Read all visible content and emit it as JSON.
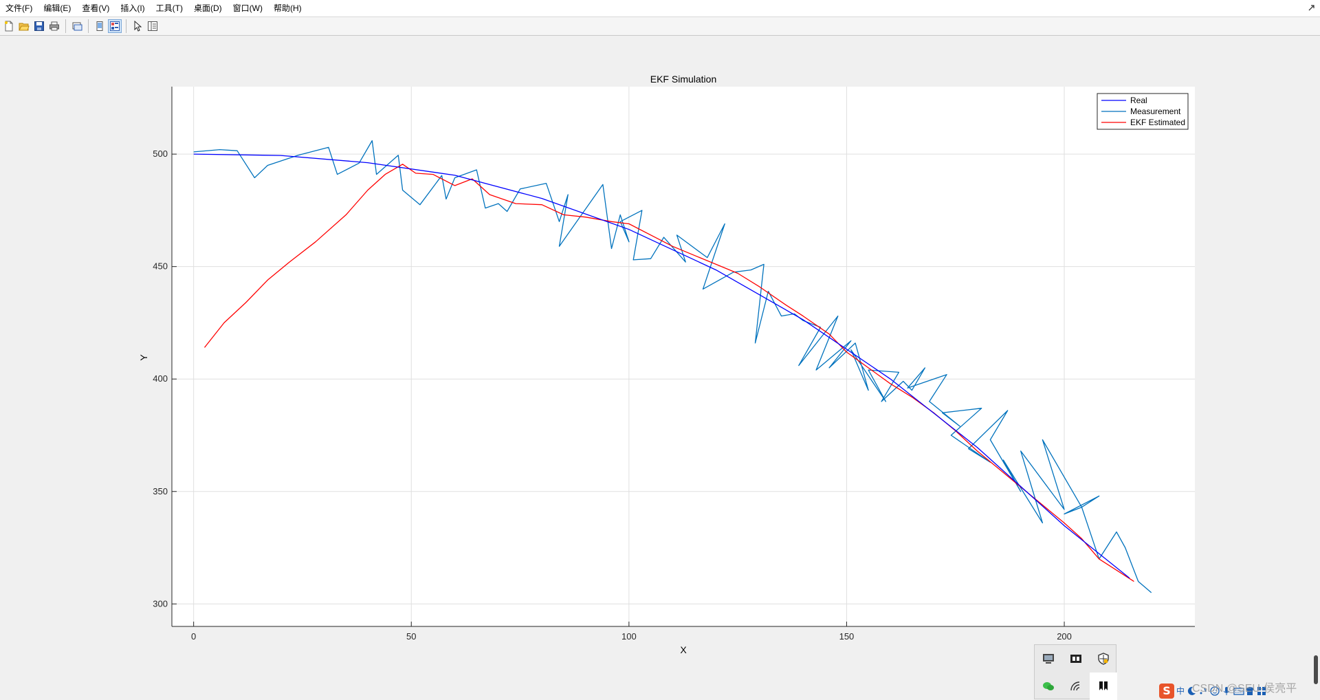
{
  "menubar": {
    "items": [
      "文件(F)",
      "编辑(E)",
      "查看(V)",
      "插入(I)",
      "工具(T)",
      "桌面(D)",
      "窗口(W)",
      "帮助(H)"
    ]
  },
  "toolbar": {
    "buttons": [
      "new-figure-icon",
      "open-file-icon",
      "save-icon",
      "print-icon",
      "link-plot-icon",
      "hide-plot-tools-icon",
      "show-plot-tools-icon",
      "edit-plot-icon",
      "property-inspector-icon"
    ]
  },
  "tray": {
    "icons": [
      "display-icon",
      "media-icon",
      "security-shield-icon",
      "wechat-icon",
      "wifi-icon",
      "bookmark-icon"
    ]
  },
  "taskbar": {
    "ime_logo": "S",
    "ime_text": "中"
  },
  "watermark": "CSDN @SEU-侯亮平",
  "colors": {
    "real": "#0000ff",
    "measurement": "#0072bd",
    "estimated": "#ff0000",
    "grid": "#dfdfdf"
  },
  "chart_data": {
    "type": "line",
    "title": "EKF Simulation",
    "xlabel": "X",
    "ylabel": "Y",
    "xlim": [
      -5,
      230
    ],
    "ylim": [
      290,
      530
    ],
    "xticks": [
      0,
      50,
      100,
      150,
      200
    ],
    "yticks": [
      300,
      350,
      400,
      450,
      500
    ],
    "grid": true,
    "legend_position": "top-right",
    "series": [
      {
        "name": "Real",
        "color": "#0000ff",
        "x": [
          0,
          20,
          40,
          60,
          80,
          100,
          120,
          140,
          160,
          180,
          200,
          215
        ],
        "y": [
          500,
          499.4,
          496.2,
          490.6,
          480.3,
          466.5,
          448.5,
          426.4,
          400.1,
          369.6,
          334.8,
          311.5
        ]
      },
      {
        "name": "Measurement",
        "color": "#0072bd",
        "x": [
          0,
          6,
          10,
          14,
          17,
          24,
          31,
          33,
          38,
          41,
          42,
          47,
          48,
          52,
          57,
          58,
          60,
          65,
          67,
          70,
          72,
          75,
          81,
          84,
          86,
          84,
          94,
          96,
          98,
          100,
          98,
          103,
          101,
          105,
          108,
          113,
          111,
          118,
          122,
          117,
          124,
          128,
          131,
          129,
          132,
          135,
          138,
          140,
          144,
          139,
          148,
          143,
          151,
          146,
          152,
          155,
          151,
          159,
          155,
          162,
          158,
          163,
          165,
          168,
          164,
          173,
          169,
          176,
          172,
          181,
          174,
          183,
          178,
          187,
          183,
          190,
          186,
          195,
          190,
          200,
          195,
          204,
          200,
          208,
          204,
          208,
          212,
          214,
          217,
          220
        ],
        "y": [
          501,
          502,
          501.5,
          489.5,
          495,
          499.5,
          503,
          491,
          496,
          506,
          491,
          499.5,
          484,
          477.5,
          490.5,
          480,
          489.5,
          493,
          476,
          478,
          474.5,
          484.5,
          487,
          470,
          482,
          459,
          486.5,
          458,
          473,
          461,
          470,
          475,
          453,
          453.5,
          463,
          452,
          464,
          454,
          469,
          440,
          447.5,
          448.5,
          451,
          416,
          439,
          428,
          429,
          426,
          423,
          406,
          428,
          404,
          417,
          405,
          416,
          395,
          413,
          390,
          404,
          403,
          390,
          399,
          395,
          405,
          396,
          402,
          390,
          379,
          385,
          387,
          375,
          363,
          369,
          386,
          373,
          350,
          364,
          336,
          368,
          342,
          373,
          343,
          340,
          348,
          343,
          320,
          332,
          325,
          310,
          305
        ]
      },
      {
        "name": "EKF Estimated",
        "color": "#ff0000",
        "x": [
          2.5,
          7,
          12,
          17,
          22,
          28,
          35,
          40,
          44,
          48,
          51,
          55,
          60,
          64,
          68,
          74,
          80,
          85,
          90,
          96,
          100,
          106,
          110,
          115,
          120,
          125,
          130,
          136,
          140,
          146,
          150,
          155,
          160,
          165,
          170,
          175,
          180,
          185,
          190,
          195,
          200,
          204,
          208,
          212,
          216
        ],
        "y": [
          414,
          425,
          434,
          444,
          452,
          461,
          473,
          484,
          491,
          495.5,
          491.5,
          491,
          486,
          489,
          482,
          478,
          477.5,
          473,
          472,
          470,
          469,
          463,
          459,
          455,
          451,
          447,
          441,
          433,
          428,
          420,
          412,
          405,
          398,
          392,
          385,
          377,
          368,
          360,
          352,
          344,
          336,
          329,
          320,
          315,
          310
        ]
      }
    ]
  }
}
